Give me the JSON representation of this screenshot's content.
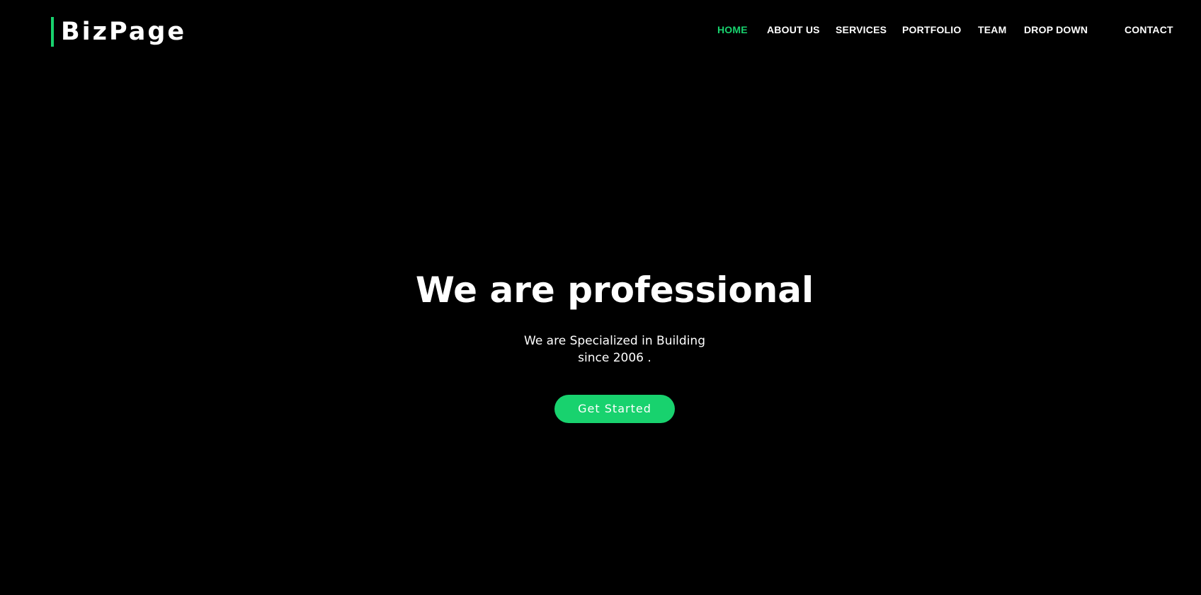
{
  "colors": {
    "background": "#000000",
    "accent": "#18d26e",
    "text": "#ffffff"
  },
  "header": {
    "logo_text": "BizPage"
  },
  "nav": {
    "items": [
      {
        "label": "HOME",
        "active": true
      },
      {
        "label": "ABOUT US",
        "active": false
      },
      {
        "label": "SERVICES",
        "active": false
      },
      {
        "label": "PORTFOLIO",
        "active": false
      },
      {
        "label": "TEAM",
        "active": false
      },
      {
        "label": "DROP DOWN",
        "active": false
      },
      {
        "label": "CONTACT",
        "active": false
      }
    ]
  },
  "hero": {
    "title": "We are professional",
    "subtitle": "We are Specialized in Building since 2006 .",
    "button_label": "Get Started"
  }
}
